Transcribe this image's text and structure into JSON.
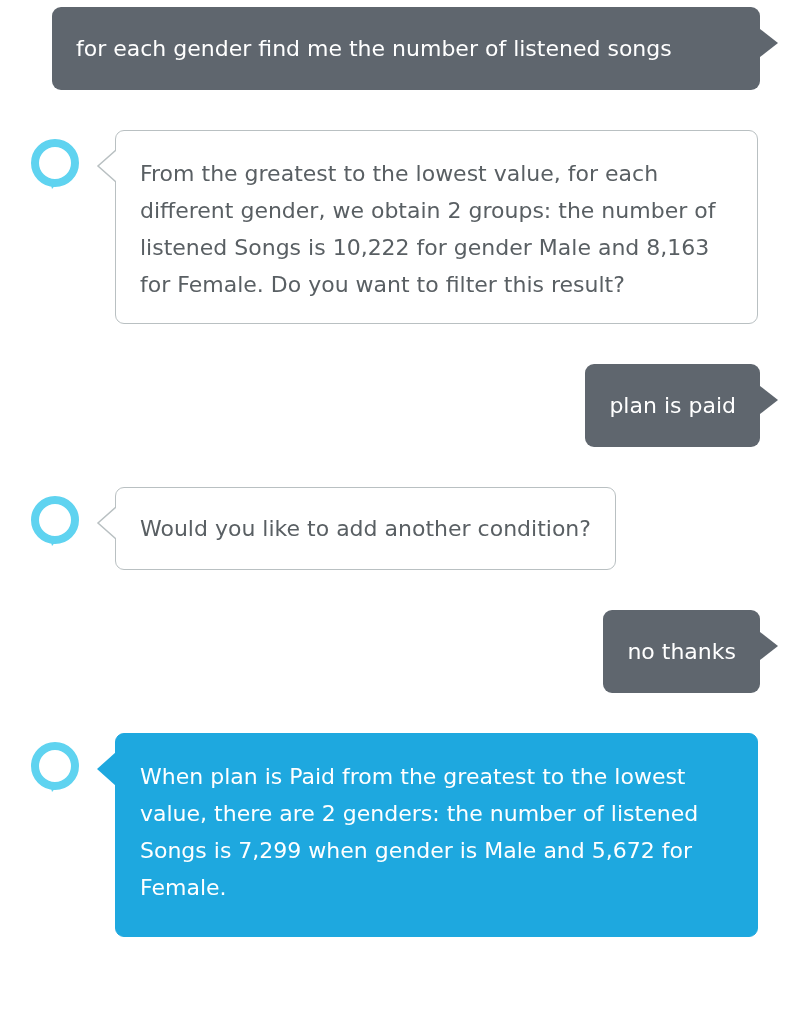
{
  "messages": [
    {
      "kind": "user",
      "text": "for each gender find me the number of listened songs"
    },
    {
      "kind": "assistant",
      "highlighted": false,
      "text": "From the greatest to the lowest value, for each different gender, we obtain 2 groups: the number of listened Songs is 10,222 for gender Male and 8,163 for Female. Do you want to filter this result?"
    },
    {
      "kind": "user",
      "text": "plan is paid"
    },
    {
      "kind": "assistant",
      "highlighted": false,
      "text": "Would you like to add another condition?"
    },
    {
      "kind": "user",
      "text": "no thanks"
    },
    {
      "kind": "assistant",
      "highlighted": true,
      "text": "When plan is Paid from the greatest to the lowest value, there are 2 genders: the number of listened Songs is 7,299 when gender is Male and 5,672 for Female."
    }
  ]
}
